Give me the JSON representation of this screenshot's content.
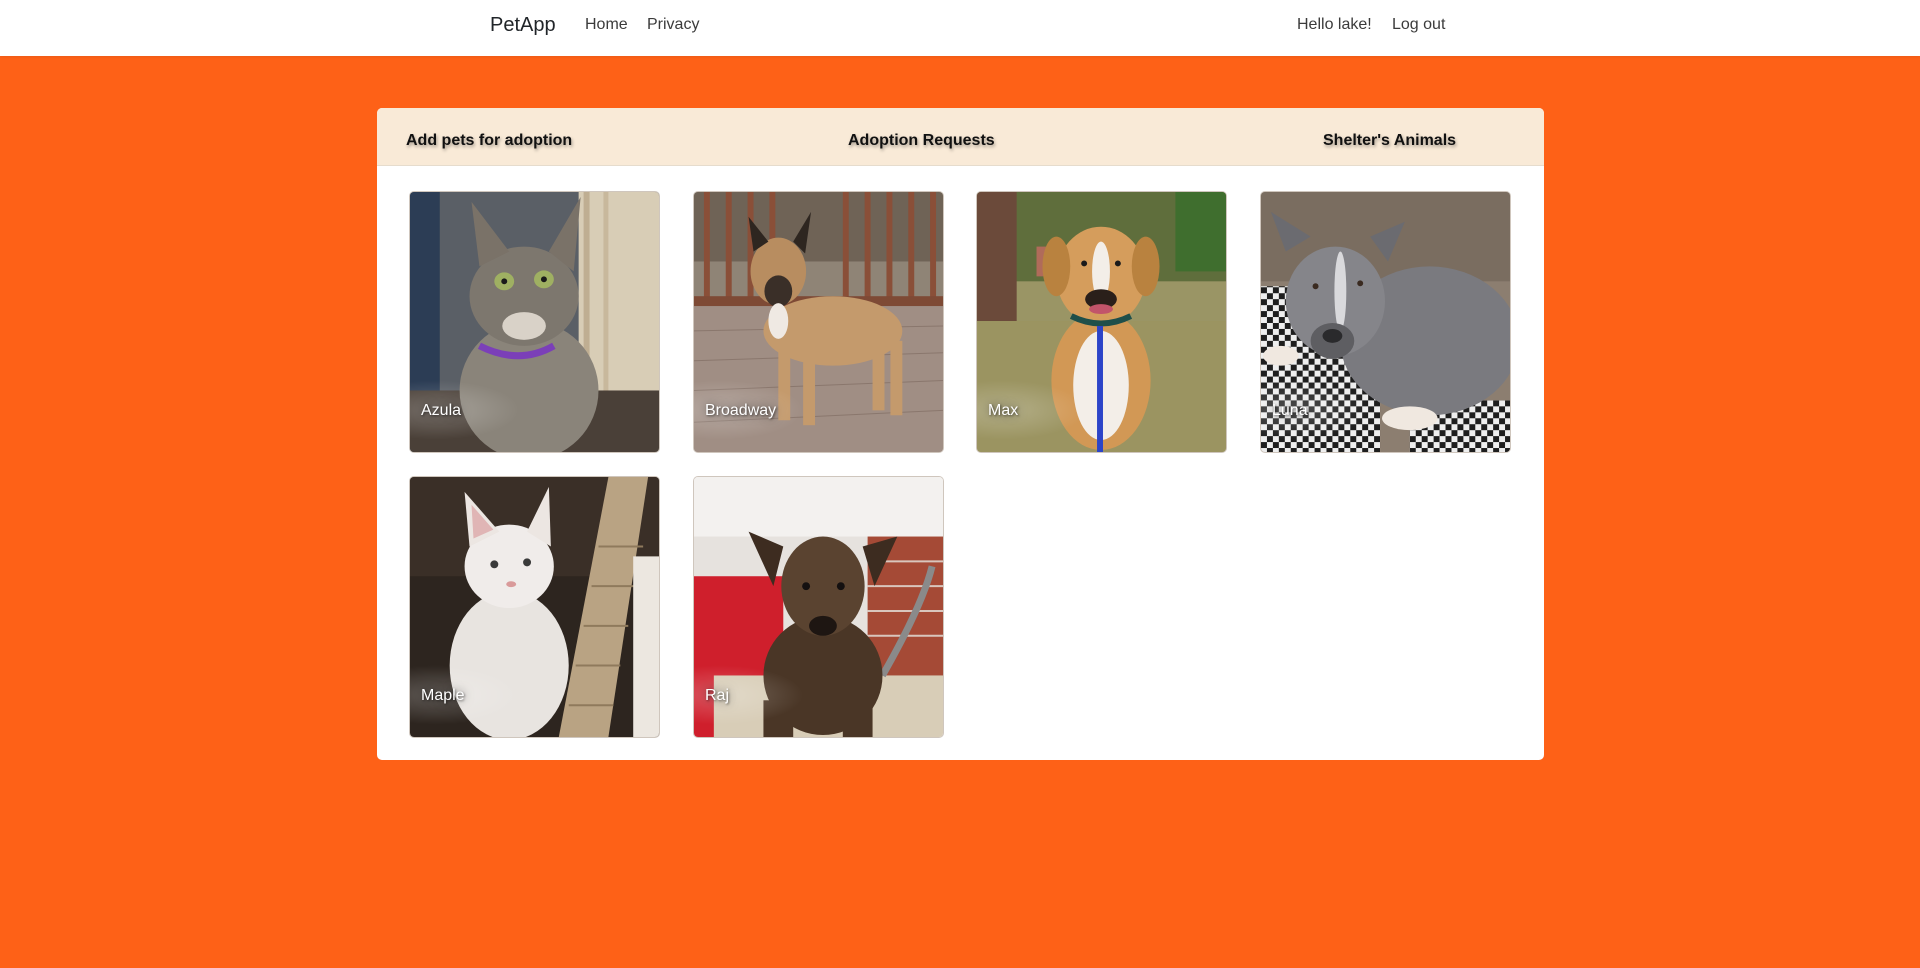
{
  "nav": {
    "brand": "PetApp",
    "links": [
      "Home",
      "Privacy"
    ],
    "greeting": "Hello lake!",
    "logout": "Log out"
  },
  "tabs": [
    "Add pets for adoption",
    "Adoption Requests",
    "Shelter's Animals"
  ],
  "pets": [
    {
      "name": "Azula"
    },
    {
      "name": "Broadway"
    },
    {
      "name": "Max"
    },
    {
      "name": "Luna"
    },
    {
      "name": "Maple"
    },
    {
      "name": "Raj"
    }
  ]
}
